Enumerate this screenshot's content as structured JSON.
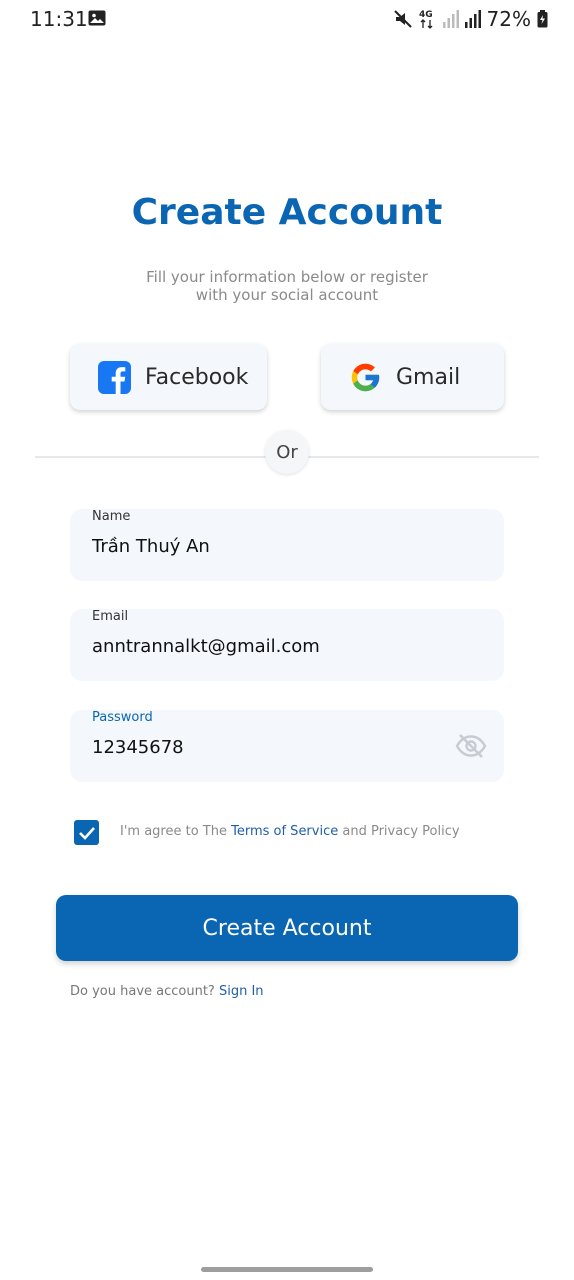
{
  "status_bar": {
    "time": "11:31",
    "network": "4G",
    "battery_percent": "72%",
    "icons": [
      "gallery-icon",
      "mute-icon",
      "signal-icon",
      "battery-icon"
    ]
  },
  "header": {
    "title": "Create Account",
    "subtitle_line1": "Fill your information below or register",
    "subtitle_line2": "with your social account"
  },
  "social": {
    "facebook_label": "Facebook",
    "gmail_label": "Gmail",
    "or_label": "Or"
  },
  "form": {
    "name_label": "Name",
    "name_value": "Trần Thuý An",
    "email_label": "Email",
    "email_value": "anntrannalkt@gmail.com",
    "password_label": "Password",
    "password_value": "12345678",
    "agree_checked": true,
    "agree_prefix": "I'm agree to The ",
    "terms_link": "Terms of Service",
    "agree_suffix": " and Privacy Policy"
  },
  "actions": {
    "create_account_label": "Create Account",
    "have_account_text": "Do you have account? ",
    "sign_in_link": "Sign In"
  },
  "colors": {
    "primary": "#0a66b2",
    "field_bg": "#f4f7fb",
    "link": "#1f5fa8"
  }
}
